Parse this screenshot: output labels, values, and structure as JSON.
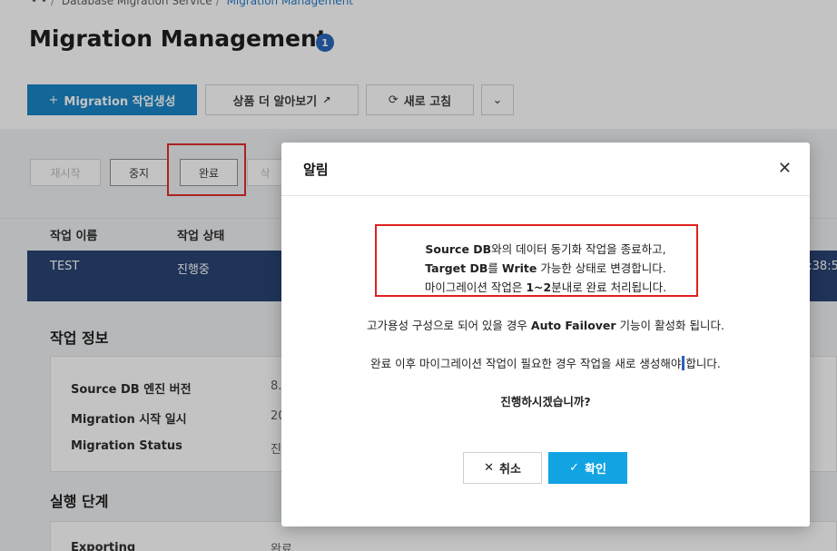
{
  "breadcrumb": {
    "prefix": "• •",
    "service": "Database Migration Service",
    "current": "Migration Management"
  },
  "page": {
    "title": "Migration Management",
    "info_badge": "1"
  },
  "toolbar": {
    "create_label": "Migration 작업생성",
    "learn_more_label": "상품 더 알아보기",
    "refresh_label": "새로 고침"
  },
  "actions": {
    "restart": "재시작",
    "stop": "중지",
    "complete": "완료",
    "delete": "삭"
  },
  "table": {
    "headers": [
      "작업 이름",
      "작업 상태"
    ],
    "row": {
      "name": "TEST",
      "status": "진행중",
      "time": "3:38:5"
    }
  },
  "job_info": {
    "title": "작업 정보",
    "fields": [
      {
        "label": "Source DB 엔진 버전",
        "value": "8."
      },
      {
        "label": "Migration 시작 일시",
        "value": "20"
      },
      {
        "label": "Migration Status",
        "value": "진"
      }
    ]
  },
  "steps": {
    "title": "실행 단계",
    "first_label": "Exporting",
    "first_value": "완료"
  },
  "modal": {
    "title": "알림",
    "line1_a": "Source DB",
    "line1_b": "와의 데이터 동기화 작업을 종료하고,",
    "line2_a": "Target DB",
    "line2_b": "를 ",
    "line2_c": "Write",
    "line2_d": " 가능한 상태로 변경합니다.",
    "line3_a": "마이그레이션 작업은 ",
    "line3_b": "1~2",
    "line3_c": "분내로 완료 처리됩니다.",
    "line4_a": "고가용성 구성으로 되어 있을 경우 ",
    "line4_b": "Auto Failover",
    "line4_c": " 기능이 활성화 됩니다.",
    "line5_a": "완료 이후 마이그레이션 작업이 필요한 경우 작업을 새로 생성해야",
    "line5_b": "합니다.",
    "line6": "진행하시겠습니까?",
    "cancel_label": "취소",
    "confirm_label": "확인"
  },
  "colors": {
    "primary": "#0b7fc4",
    "confirm": "#12a3e3",
    "highlight": "#e0201e",
    "selected_row": "#1d3a6b"
  }
}
